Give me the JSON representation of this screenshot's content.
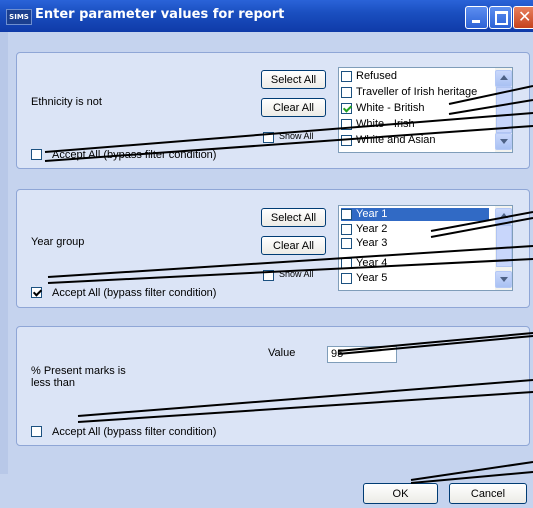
{
  "window": {
    "app_icon_text": "SIMS",
    "title": "Enter parameter values for report",
    "controls": [
      "minimize",
      "maximize",
      "close"
    ]
  },
  "section_ethnicity": {
    "label": "Ethnicity is not",
    "select_all": "Select All",
    "clear_all": "Clear All",
    "show_all": "Show All",
    "accept_all": "Accept All (bypass filter condition)",
    "accept_all_checked": false,
    "items": [
      {
        "label": "Refused",
        "checked": false
      },
      {
        "label": "Traveller of Irish heritage",
        "checked": false
      },
      {
        "label": "White - British",
        "checked": true
      },
      {
        "label": "White - Irish",
        "checked": false
      },
      {
        "label": "White and Asian",
        "checked": false
      }
    ]
  },
  "section_year": {
    "label": "Year group",
    "select_all": "Select All",
    "clear_all": "Clear All",
    "show_all": "Show All",
    "accept_all": "Accept All (bypass filter condition)",
    "accept_all_checked": true,
    "items": [
      {
        "label": "Year 1",
        "checked": false,
        "selected": true
      },
      {
        "label": "Year 2",
        "checked": false
      },
      {
        "label": "Year 3",
        "checked": false
      },
      {
        "label": "Year 4",
        "checked": false
      },
      {
        "label": "Year 5",
        "checked": false
      }
    ]
  },
  "section_present": {
    "label": "% Present marks is less than",
    "value_label": "Value",
    "value": "95",
    "accept_all": "Accept All (bypass filter condition)",
    "accept_all_checked": false
  },
  "footer": {
    "ok": "OK",
    "cancel": "Cancel"
  }
}
